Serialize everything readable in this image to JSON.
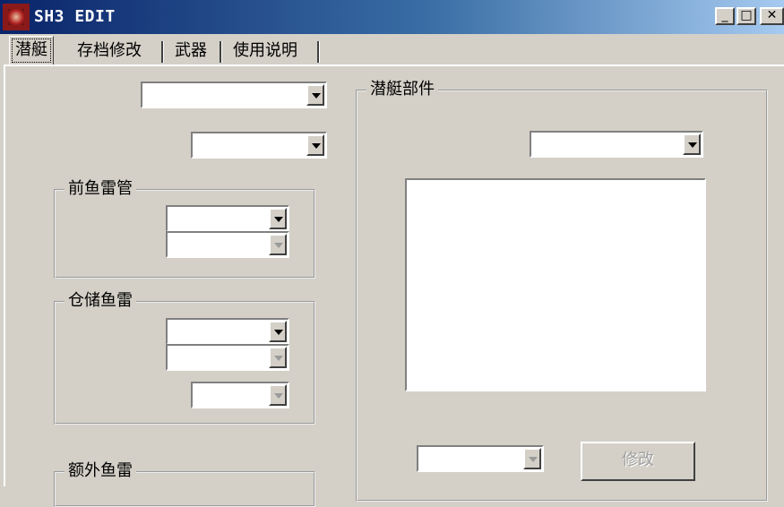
{
  "window": {
    "title": "SH3 EDIT",
    "icon": "app-icon"
  },
  "controls": {
    "minimize": "_",
    "maximize": "□",
    "close": "✕"
  },
  "tabs": [
    {
      "label": "潜艇",
      "active": true
    },
    {
      "label": "存档修改",
      "active": false
    },
    {
      "label": "武器",
      "active": false
    },
    {
      "label": "使用说明",
      "active": false
    }
  ],
  "groups": {
    "front_tubes": "前鱼雷管",
    "stored_torpedoes": "仓储鱼雷",
    "extra_torpedoes": "额外鱼雷",
    "sub_parts": "潜艇部件"
  },
  "buttons": {
    "modify": "修改"
  }
}
